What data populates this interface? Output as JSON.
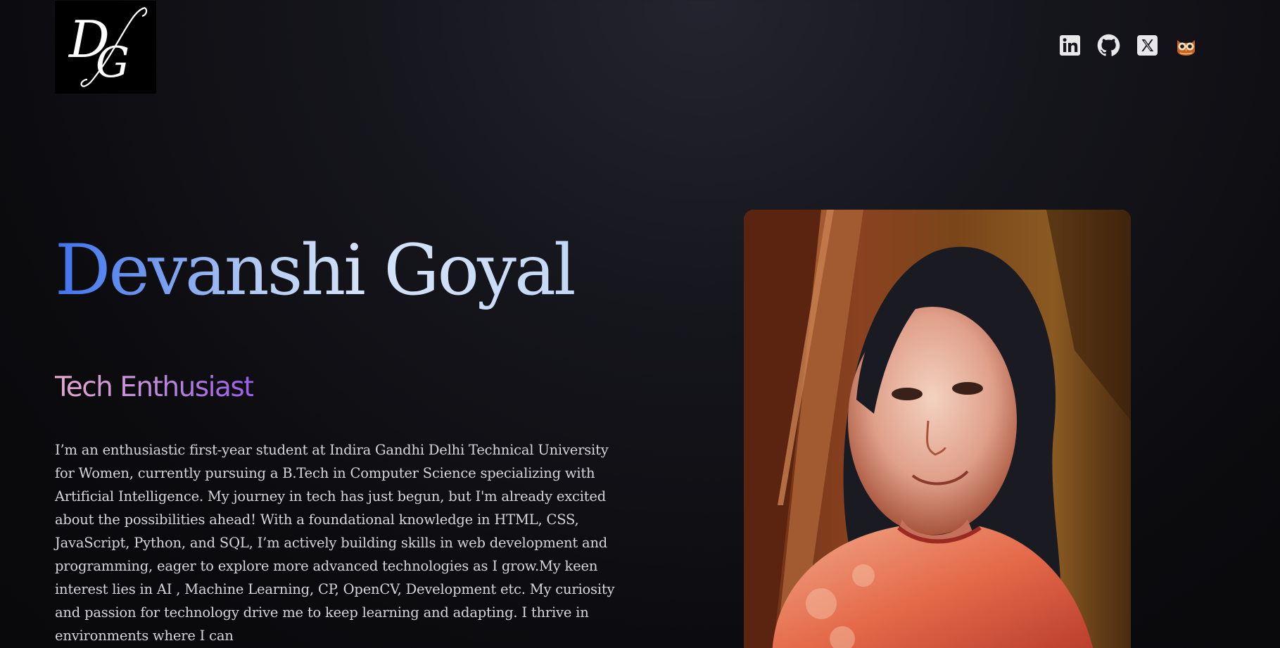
{
  "logo": {
    "text": "DG"
  },
  "social": [
    {
      "name": "LinkedIn",
      "icon": "linkedin-icon"
    },
    {
      "name": "GitHub",
      "icon": "github-icon"
    },
    {
      "name": "X",
      "icon": "x-icon"
    },
    {
      "name": "Owl",
      "icon": "owl-icon"
    }
  ],
  "hero": {
    "name": "Devanshi Goyal",
    "tagline": "Tech Enthusiast",
    "bio": "I’m an enthusiastic first-year student at Indira Gandhi Delhi Technical University for Women, currently pursuing a B.Tech in Computer Science specializing with Artificial Intelligence. My journey in tech has just begun, but I'm already excited about the possibilities ahead! With a foundational knowledge in HTML, CSS, JavaScript, Python, and SQL, I’m actively building skills in web development and programming, eager to explore more advanced technologies as I grow.My keen interest lies in AI , Machine Learning, CP, OpenCV, Development etc. My curiosity and passion for technology drive me to keep learning and adapting. I thrive in environments where I can"
  },
  "colors": {
    "background": "#0b0b0e",
    "name_gradient_start": "#3f72ee",
    "name_gradient_end": "#d6e3f8",
    "tagline_gradient_start": "#e4a8ce",
    "tagline_gradient_end": "#9a5ee8",
    "bio_text": "#d6d6dc"
  }
}
